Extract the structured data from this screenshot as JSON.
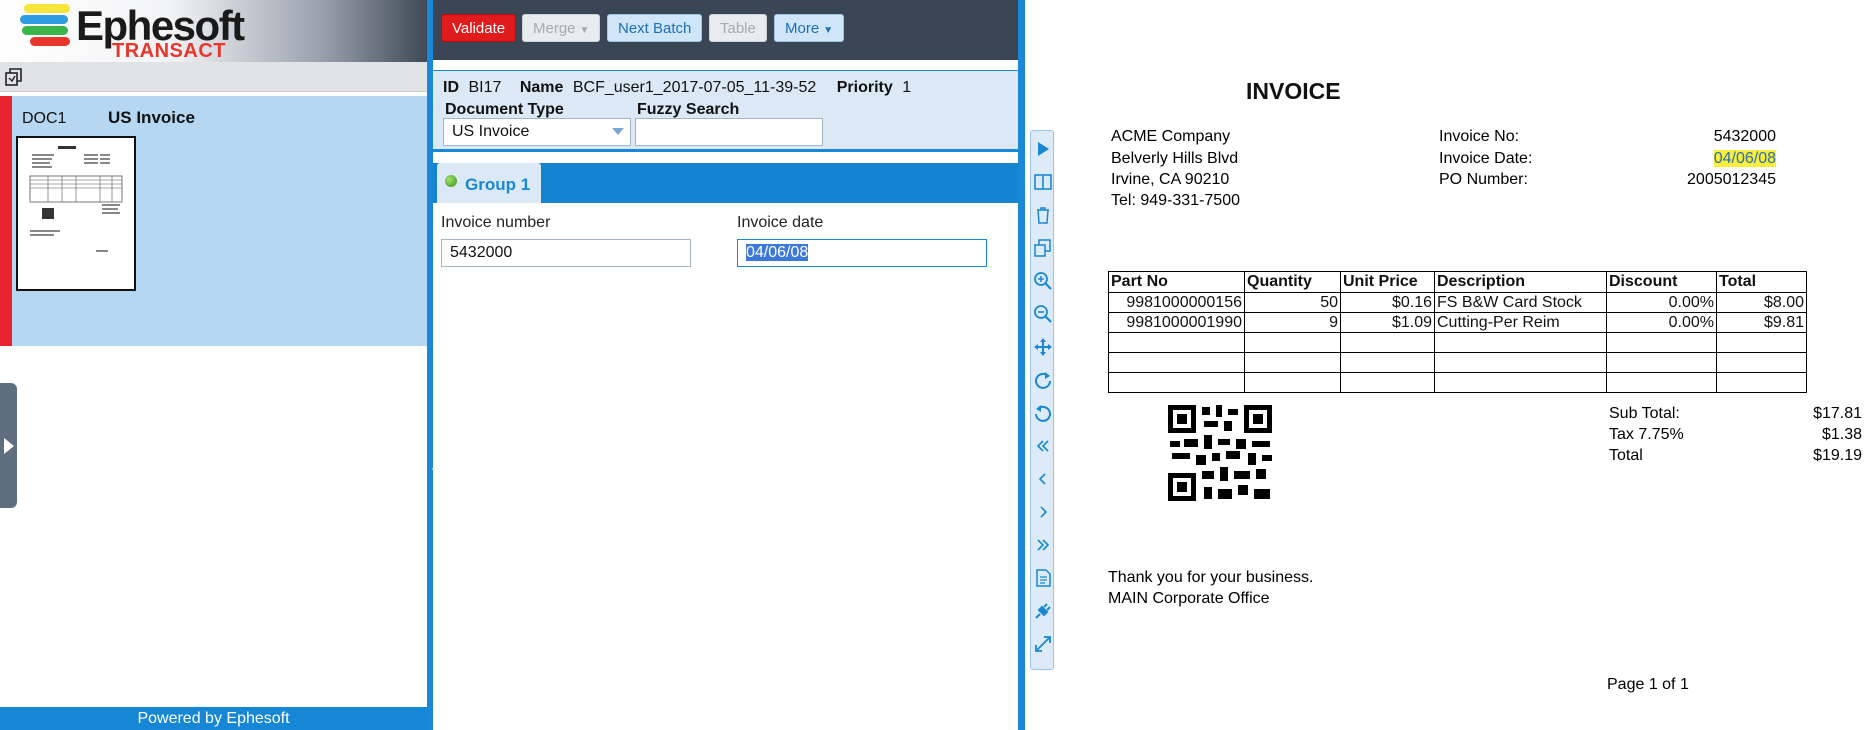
{
  "app": {
    "logo_word": "Ephesoft",
    "logo_sub": "TRANSACT",
    "footer": "Powered by Ephesoft",
    "colors": {
      "accent": "#1a88d4",
      "danger": "#e11b1b",
      "header": "#3a4656",
      "selection": "#b5d7f1",
      "highlight": "#f7ef3c"
    }
  },
  "left": {
    "toolbar_icon": "copy-icon",
    "document": {
      "id": "DOC1",
      "type": "US Invoice"
    },
    "expander_icon": "expand-right-icon"
  },
  "toolbar": {
    "validate": "Validate",
    "merge": "Merge",
    "next_batch": "Next Batch",
    "table": "Table",
    "more": "More"
  },
  "batch": {
    "id_label": "ID",
    "id_value": "BI17",
    "name_label": "Name",
    "name_value": "BCF_user1_2017-07-05_11-39-52",
    "priority_label": "Priority",
    "priority_value": "1",
    "doc_type_label": "Document Type",
    "doc_type_value": "US Invoice",
    "fuzzy_label": "Fuzzy Search",
    "fuzzy_value": ""
  },
  "group": {
    "tab_label": "Group 1",
    "fields": [
      {
        "label": "Invoice number",
        "value": "5432000"
      },
      {
        "label": "Invoice date",
        "value": "04/06/08"
      }
    ]
  },
  "tools": [
    "play-icon",
    "split-icon",
    "delete-icon",
    "copy-icon",
    "zoom-in-icon",
    "zoom-out-icon",
    "move-icon",
    "rotate-right-icon",
    "rotate-left-icon",
    "first-page-icon",
    "prev-page-icon",
    "next-page-icon",
    "last-page-icon",
    "document-icon",
    "plugin-icon",
    "fit-icon"
  ],
  "invoice": {
    "title": "INVOICE",
    "company": [
      "ACME Company",
      "Belverly Hills Blvd",
      "Irvine, CA 90210",
      "Tel: 949-331-7500"
    ],
    "meta_labels": [
      "Invoice No:",
      "Invoice Date:",
      "PO Number:"
    ],
    "meta_values": [
      "5432000",
      "04/06/08",
      "2005012345"
    ],
    "table_headers": [
      "Part No",
      "Quantity",
      "Unit Price",
      "Description",
      "Discount",
      "Total"
    ],
    "rows": [
      [
        "9981000000156",
        "50",
        "$0.16",
        "FS B&W Card Stock",
        "0.00%",
        "$8.00"
      ],
      [
        "9981000001990",
        "9",
        "$1.09",
        "Cutting-Per Reim",
        "0.00%",
        "$9.81"
      ]
    ],
    "totals_labels": [
      "Sub Total:",
      "Tax 7.75%",
      "Total"
    ],
    "totals_values": [
      "$17.81",
      "$1.38",
      "$19.19"
    ],
    "thanks": "Thank you for your business.",
    "office": "MAIN Corporate Office",
    "page": "Page 1 of 1"
  }
}
